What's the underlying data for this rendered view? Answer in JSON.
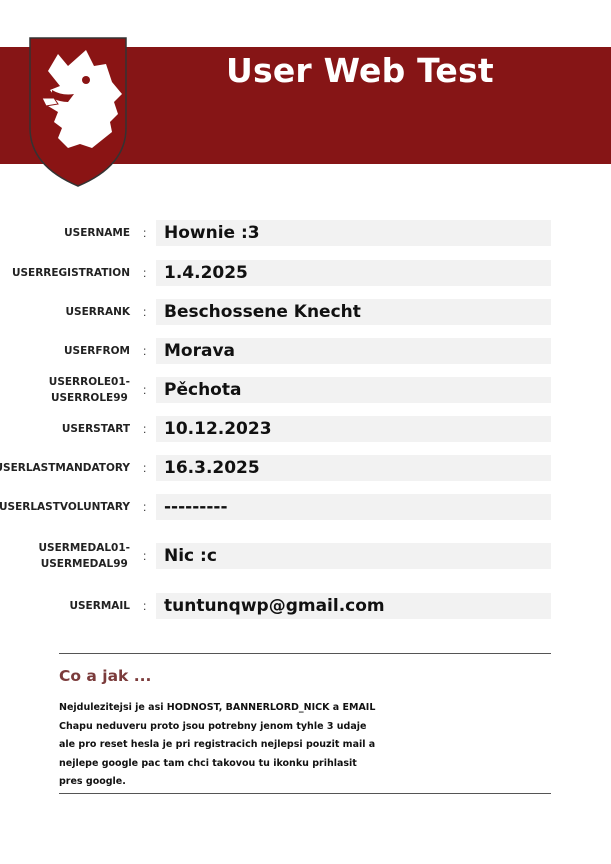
{
  "colors": {
    "brand": "#861516",
    "accent": "#7b3b3b",
    "value_bg": "#f2f2f2"
  },
  "header": {
    "title": "User Web Test",
    "logo_icon": "wolf-head-shield-icon"
  },
  "fields": [
    {
      "label": "USERNAME",
      "value": "Hownie :3"
    },
    {
      "label": "USERREGISTRATION",
      "value": "1.4.2025"
    },
    {
      "label": "USERRANK",
      "value": "Beschossene Knecht"
    },
    {
      "label": "USERFROM",
      "value": "Morava"
    },
    {
      "label_line1": "USERROLE01-",
      "label_line2": "USERROLE99",
      "value": "Pěchota"
    },
    {
      "label": "USERSTART",
      "value": "10.12.2023"
    },
    {
      "label": "USERLASTMANDATORY",
      "value": "16.3.2025"
    },
    {
      "label": "USERLASTVOLUNTARY",
      "value": "---------"
    },
    {
      "label_line1": "USERMEDAL01-",
      "label_line2": "USERMEDAL99",
      "value": "Nic :c"
    },
    {
      "label": "USERMAIL",
      "value": "tuntunqwp@gmail.com"
    }
  ],
  "colon": ":",
  "notes": {
    "title": "Co a jak ...",
    "lines": [
      "Nejdulezitejsi je asi HODNOST, BANNERLORD_NICK a EMAIL",
      "Chapu neduveru proto jsou potrebny jenom tyhle 3 udaje",
      "ale pro reset hesla je pri registracich nejlepsi pouzit mail a",
      "nejlepe google pac tam chci takovou tu ikonku prihlasit",
      "pres google."
    ]
  }
}
